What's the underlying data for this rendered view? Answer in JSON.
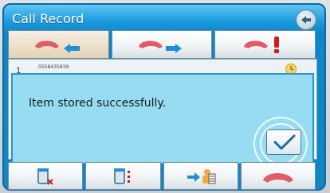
{
  "window": {
    "title": "Call Record"
  },
  "tabs": [
    {
      "icon": "incoming-call-icon",
      "active": true
    },
    {
      "icon": "outgoing-call-icon",
      "active": false
    },
    {
      "icon": "missed-call-icon",
      "active": false
    }
  ],
  "list": {
    "items": [
      {
        "index": "1",
        "number": "0558435839"
      }
    ]
  },
  "dialog": {
    "message": "Item stored successfully.",
    "confirm_icon": "checkmark-icon"
  },
  "toolbar": {
    "buttons": [
      {
        "icon": "delete-item-icon"
      },
      {
        "icon": "delete-all-icon"
      },
      {
        "icon": "save-to-contacts-icon"
      },
      {
        "icon": "end-call-icon"
      }
    ]
  },
  "colors": {
    "frame": "#0f86c8",
    "dialog_bg": "#96dcf3",
    "handset": "#e25b67",
    "arrow": "#1c8fd6",
    "missed": "#d11a1a"
  }
}
